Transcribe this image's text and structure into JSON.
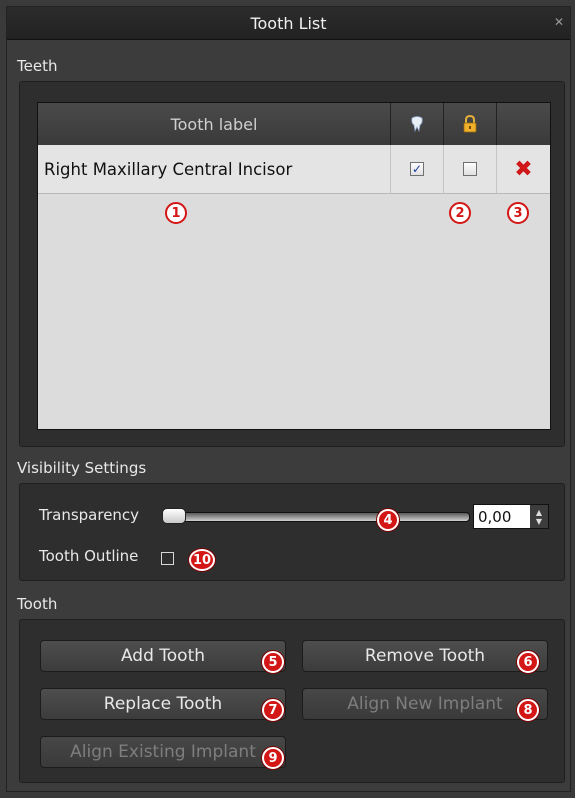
{
  "window": {
    "title": "Tooth List",
    "close_glyph": "✕"
  },
  "teeth": {
    "section_label": "Teeth",
    "columns": {
      "label": "Tooth label",
      "visible_icon": "tooth-icon",
      "lock_icon": "lock-icon"
    },
    "rows": [
      {
        "label": "Right Maxillary Central Incisor",
        "visible": true,
        "locked": false,
        "delete_icon": "delete-x-icon"
      }
    ]
  },
  "visibility": {
    "section_label": "Visibility Settings",
    "transparency_label": "Transparency",
    "transparency_value": "0,00",
    "transparency_fraction": 0.0,
    "outline_label": "Tooth Outline",
    "outline_checked": false
  },
  "tooth": {
    "section_label": "Tooth",
    "add": "Add Tooth",
    "remove": "Remove Tooth",
    "replace": "Replace Tooth",
    "align_new": "Align New Implant",
    "align_existing": "Align Existing Implant"
  },
  "callouts": [
    "1",
    "2",
    "3",
    "4",
    "5",
    "6",
    "7",
    "8",
    "9",
    "10"
  ],
  "colors": {
    "callout": "#d31616",
    "delete": "#d01818",
    "background": "#3c3c3c"
  }
}
